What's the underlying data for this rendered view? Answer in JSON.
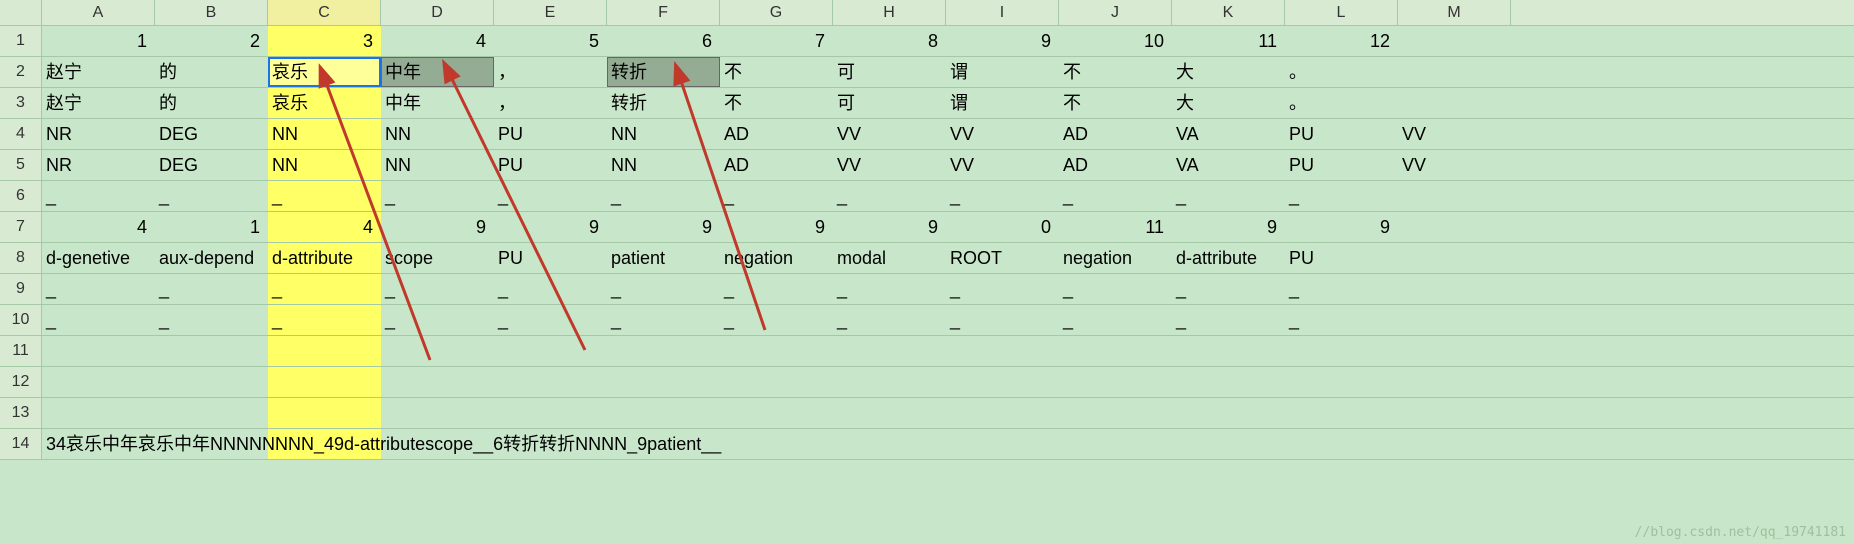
{
  "columns": [
    "A",
    "B",
    "C",
    "D",
    "E",
    "F",
    "G",
    "H",
    "I",
    "J",
    "K",
    "L",
    "M"
  ],
  "highlight_col": "C",
  "selected_cells": [
    "C2"
  ],
  "gray_selected": [
    "D2",
    "F2"
  ],
  "rows": [
    {
      "n": 1,
      "type": "num",
      "c": [
        "1",
        "2",
        "3",
        "4",
        "5",
        "6",
        "7",
        "8",
        "9",
        "10",
        "11",
        "12",
        ""
      ]
    },
    {
      "n": 2,
      "type": "txt",
      "c": [
        "赵宁",
        "的",
        "哀乐",
        "中年",
        "，",
        "转折",
        "不",
        "可",
        "谓",
        "不",
        "大",
        "。",
        ""
      ]
    },
    {
      "n": 3,
      "type": "txt",
      "c": [
        "赵宁",
        "的",
        "哀乐",
        "中年",
        "，",
        "转折",
        "不",
        "可",
        "谓",
        "不",
        "大",
        "。",
        ""
      ]
    },
    {
      "n": 4,
      "type": "txt",
      "c": [
        "NR",
        "DEG",
        "NN",
        "NN",
        "PU",
        "NN",
        "AD",
        "VV",
        "VV",
        "AD",
        "VA",
        "PU",
        "VV"
      ]
    },
    {
      "n": 5,
      "type": "txt",
      "c": [
        "NR",
        "DEG",
        "NN",
        "NN",
        "PU",
        "NN",
        "AD",
        "VV",
        "VV",
        "AD",
        "VA",
        "PU",
        "VV"
      ]
    },
    {
      "n": 6,
      "type": "txt",
      "c": [
        "_",
        "_",
        "_",
        "_",
        "_",
        "_",
        "_",
        "_",
        "_",
        "_",
        "_",
        "_",
        ""
      ]
    },
    {
      "n": 7,
      "type": "num",
      "c": [
        "4",
        "1",
        "4",
        "9",
        "9",
        "9",
        "9",
        "9",
        "0",
        "11",
        "9",
        "9",
        ""
      ]
    },
    {
      "n": 8,
      "type": "txt",
      "c": [
        "d-genetive",
        "aux-depend",
        "d-attribute",
        "scope",
        "PU",
        "patient",
        "negation",
        "modal",
        "ROOT",
        "negation",
        "d-attribute",
        "PU",
        ""
      ]
    },
    {
      "n": 9,
      "type": "txt",
      "c": [
        "_",
        "_",
        "_",
        "_",
        "_",
        "_",
        "_",
        "_",
        "_",
        "_",
        "_",
        "_",
        ""
      ]
    },
    {
      "n": 10,
      "type": "txt",
      "c": [
        "_",
        "_",
        "_",
        "_",
        "_",
        "_",
        "_",
        "_",
        "_",
        "_",
        "_",
        "_",
        ""
      ]
    },
    {
      "n": 11,
      "type": "txt",
      "c": [
        "",
        "",
        "",
        "",
        "",
        "",
        "",
        "",
        "",
        "",
        "",
        "",
        ""
      ]
    },
    {
      "n": 12,
      "type": "txt",
      "c": [
        "",
        "",
        "",
        "",
        "",
        "",
        "",
        "",
        "",
        "",
        "",
        "",
        ""
      ]
    },
    {
      "n": 13,
      "type": "txt",
      "c": [
        "",
        "",
        "",
        "",
        "",
        "",
        "",
        "",
        "",
        "",
        "",
        "",
        ""
      ]
    }
  ],
  "row14_merged": "34哀乐中年哀乐中年NNNNNNNN_49d-attributescope__6转折转折NNNN_9patient__",
  "watermark": "//blog.csdn.net/qq_19741181"
}
